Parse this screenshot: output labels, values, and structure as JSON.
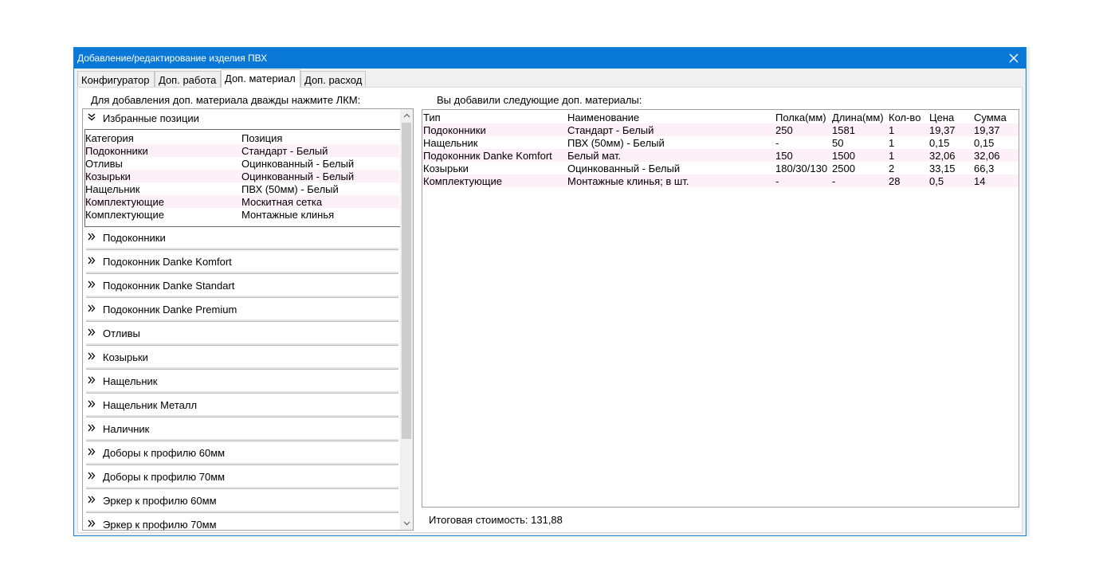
{
  "window": {
    "title": "Добавление/редактирование изделия ПВХ"
  },
  "tabs": [
    {
      "label": "Конфигуратор",
      "active": false
    },
    {
      "label": "Доп. работа",
      "active": false
    },
    {
      "label": "Доп. материал",
      "active": true
    },
    {
      "label": "Доп. расход",
      "active": false
    }
  ],
  "left": {
    "instruction": "Для добавления доп. материала дважды нажмите ЛКМ:",
    "favorites_title": "Избранные позиции",
    "favorites_columns": [
      "Категория",
      "Позиция"
    ],
    "favorites_rows": [
      [
        "Подоконники",
        "Стандарт - Белый"
      ],
      [
        "Отливы",
        "Оцинкованный - Белый"
      ],
      [
        "Козырьки",
        "Оцинкованный - Белый"
      ],
      [
        "Нащельник",
        "ПВХ (50мм) - Белый"
      ],
      [
        "Комплектующие",
        "Москитная сетка"
      ],
      [
        "Комплектующие",
        "Монтажные клинья"
      ]
    ],
    "groups": [
      "Подоконники",
      "Подоконник Danke Komfort",
      "Подоконник Danke Standart",
      "Подоконник Danke Premium",
      "Отливы",
      "Козырьки",
      "Нащельник",
      "Нащельник Металл",
      "Наличник",
      "Доборы к профилю 60мм",
      "Доборы к профилю 70мм",
      "Эркер к профилю 60мм",
      "Эркер к профилю 70мм"
    ]
  },
  "right": {
    "heading": "Вы добавили следующие доп. материалы:",
    "columns": [
      "Тип",
      "Наименование",
      "Полка(мм)",
      "Длина(мм)",
      "Кол-во",
      "Цена",
      "Сумма"
    ],
    "rows": [
      [
        "Подоконники",
        "Стандарт - Белый",
        "250",
        "1581",
        "1",
        "19,37",
        "19,37"
      ],
      [
        "Нащельник",
        "ПВХ (50мм) - Белый",
        "-",
        "50",
        "1",
        "0,15",
        "0,15"
      ],
      [
        "Подоконник Danke Komfort",
        "Белый мат.",
        "150",
        "1500",
        "1",
        "32,06",
        "32,06"
      ],
      [
        "Козырьки",
        "Оцинкованный - Белый",
        "180/30/130",
        "2500",
        "2",
        "33,15",
        "66,3"
      ],
      [
        "Комплектующие",
        "Монтажные клинья; в шт.",
        "-",
        "-",
        "28",
        "0,5",
        "14"
      ]
    ],
    "total_label": "Итоговая стоимость: 131,88"
  },
  "icons": {
    "close": "close-icon",
    "expanded": "chevron-double-down-icon",
    "collapsed": "chevron-double-right-icon",
    "scroll_up": "arrow-up-icon",
    "scroll_down": "arrow-down-icon"
  },
  "colors": {
    "titlebar": "#0a78d7",
    "row_alt": "#fdf0f8"
  }
}
